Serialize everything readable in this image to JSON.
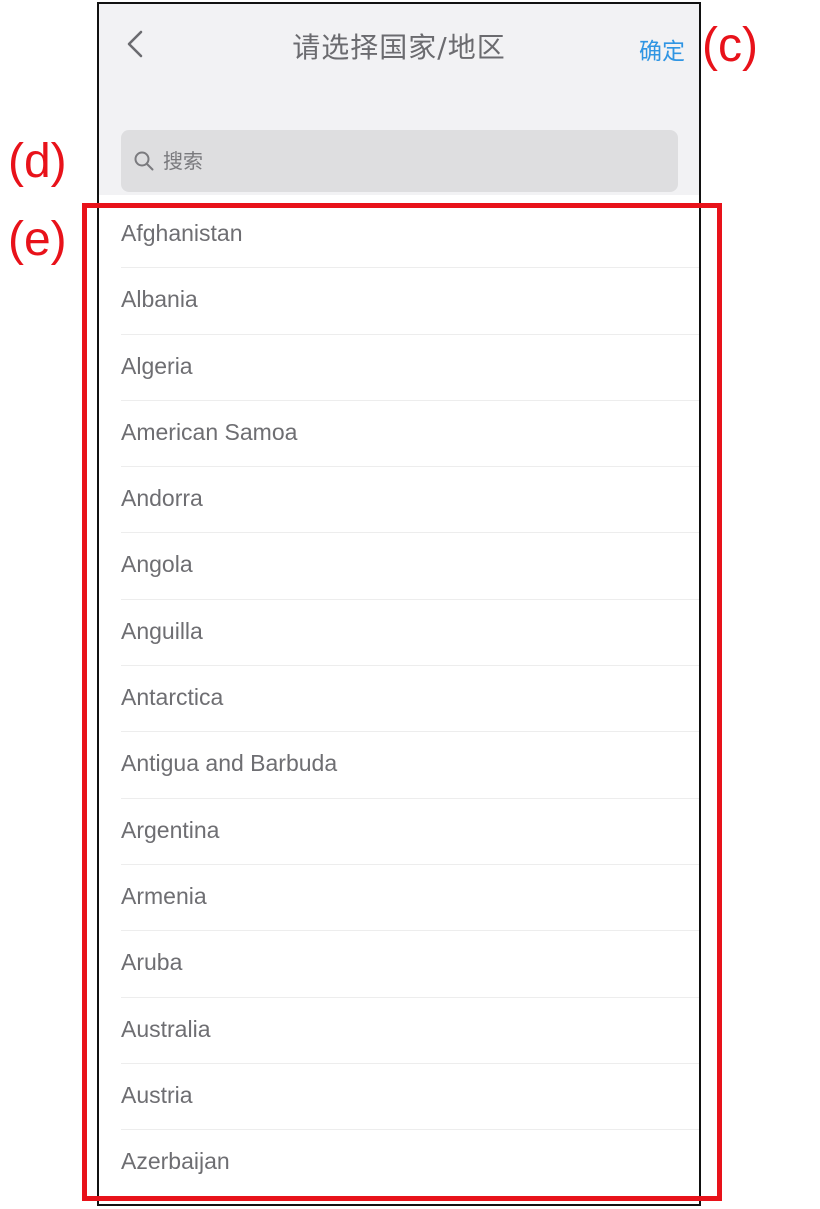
{
  "header": {
    "title": "请选择国家/地区",
    "confirm_label": "确定",
    "back_icon": "chevron-left-icon"
  },
  "search": {
    "placeholder": "搜索",
    "value": "",
    "icon": "search-icon"
  },
  "countries": [
    "Afghanistan",
    "Albania",
    "Algeria",
    "American Samoa",
    "Andorra",
    "Angola",
    "Anguilla",
    "Antarctica",
    "Antigua and Barbuda",
    "Argentina",
    "Armenia",
    "Aruba",
    "Australia",
    "Austria",
    "Azerbaijan"
  ],
  "annotations": {
    "c": "(c)",
    "d": "(d)",
    "e": "(e)"
  },
  "colors": {
    "accent": "#2f95e3",
    "annotation": "#e8121a",
    "header_bg": "#f2f2f4",
    "search_bg": "#dedee0"
  }
}
